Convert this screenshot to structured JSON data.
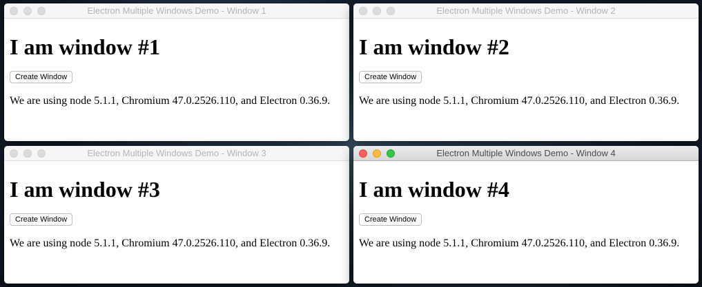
{
  "windows": [
    {
      "title": "Electron Multiple Windows Demo - Window 1",
      "heading": "I am window #1",
      "button_label": "Create Window",
      "versions_text": "We are using node 5.1.1, Chromium 47.0.2526.110, and Electron 0.36.9.",
      "active": false
    },
    {
      "title": "Electron Multiple Windows Demo - Window 2",
      "heading": "I am window #2",
      "button_label": "Create Window",
      "versions_text": "We are using node 5.1.1, Chromium 47.0.2526.110, and Electron 0.36.9.",
      "active": false
    },
    {
      "title": "Electron Multiple Windows Demo - Window 3",
      "heading": "I am window #3",
      "button_label": "Create Window",
      "versions_text": "We are using node 5.1.1, Chromium 47.0.2526.110, and Electron 0.36.9.",
      "active": false
    },
    {
      "title": "Electron Multiple Windows Demo - Window 4",
      "heading": "I am window #4",
      "button_label": "Create Window",
      "versions_text": "We are using node 5.1.1, Chromium 47.0.2526.110, and Electron 0.36.9.",
      "active": true
    }
  ],
  "colors": {
    "close": "#fc605c",
    "minimize": "#fdbc40",
    "zoom": "#34c84a"
  }
}
